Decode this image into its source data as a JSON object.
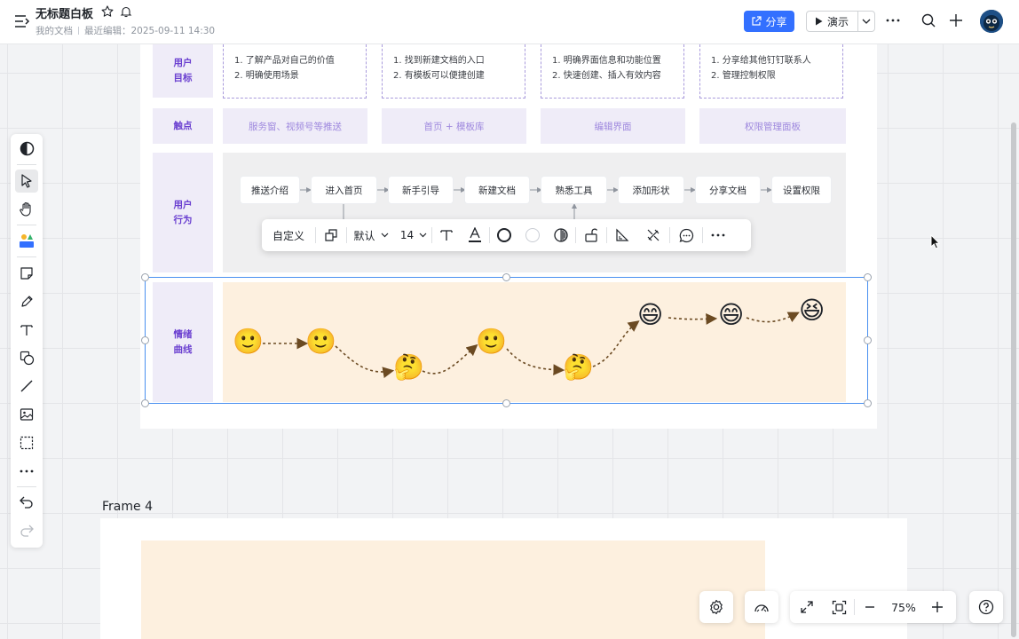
{
  "header": {
    "title": "无标题白板",
    "location": "我的文档",
    "last_edited": "最近编辑：2025-09-11 14:30",
    "share_label": "分享",
    "present_label": "演示"
  },
  "board": {
    "rows": [
      {
        "label_line1": "用户",
        "label_line2": "目标"
      },
      {
        "label_line1": "触点",
        "label_line2": ""
      },
      {
        "label_line1": "用户",
        "label_line2": "行为"
      },
      {
        "label_line1": "情绪",
        "label_line2": "曲线"
      }
    ],
    "goals": [
      {
        "line1": "1. 了解产品对自己的价值",
        "line2": "2. 明确使用场景"
      },
      {
        "line1": "1. 找到新建文档的入口",
        "line2": "2. 有模板可以便捷创建"
      },
      {
        "line1": "1. 明确界面信息和功能位置",
        "line2": "2. 快速创建、插入有效内容"
      },
      {
        "line1": "1. 分享给其他钉钉联系人",
        "line2": "2. 管理控制权限"
      }
    ],
    "touchpoints": [
      "服务窗、视频号等推送",
      "首页 + 模板库",
      "编辑界面",
      "权限管理面板"
    ],
    "steps": [
      "推送介绍",
      "进入首页",
      "新手引导",
      "新建文档",
      "熟悉工具",
      "添加形状",
      "分享文档",
      "设置权限"
    ],
    "emotions": [
      {
        "emoji": "🙂",
        "name": "smile"
      },
      {
        "emoji": "🙂",
        "name": "smile"
      },
      {
        "emoji": "🤔",
        "name": "confused"
      },
      {
        "emoji": "🙂",
        "name": "smile"
      },
      {
        "emoji": "🤔",
        "name": "confused"
      },
      {
        "emoji": "😄",
        "name": "grin"
      },
      {
        "emoji": "😄",
        "name": "grin"
      },
      {
        "emoji": "😆",
        "name": "laugh"
      }
    ]
  },
  "format_toolbar": {
    "style_label": "自定义",
    "font_label": "默认",
    "font_size": "14"
  },
  "frame4": {
    "title": "Frame 4"
  },
  "zoom": {
    "value": "75%"
  },
  "colors": {
    "accent": "#3370ff",
    "purple_label": "#6a3fd0",
    "label_bg": "#efecf8",
    "emotion_bg": "#fdf0df",
    "arrow_brown": "#6b4a22",
    "selection": "#4a90f0"
  }
}
